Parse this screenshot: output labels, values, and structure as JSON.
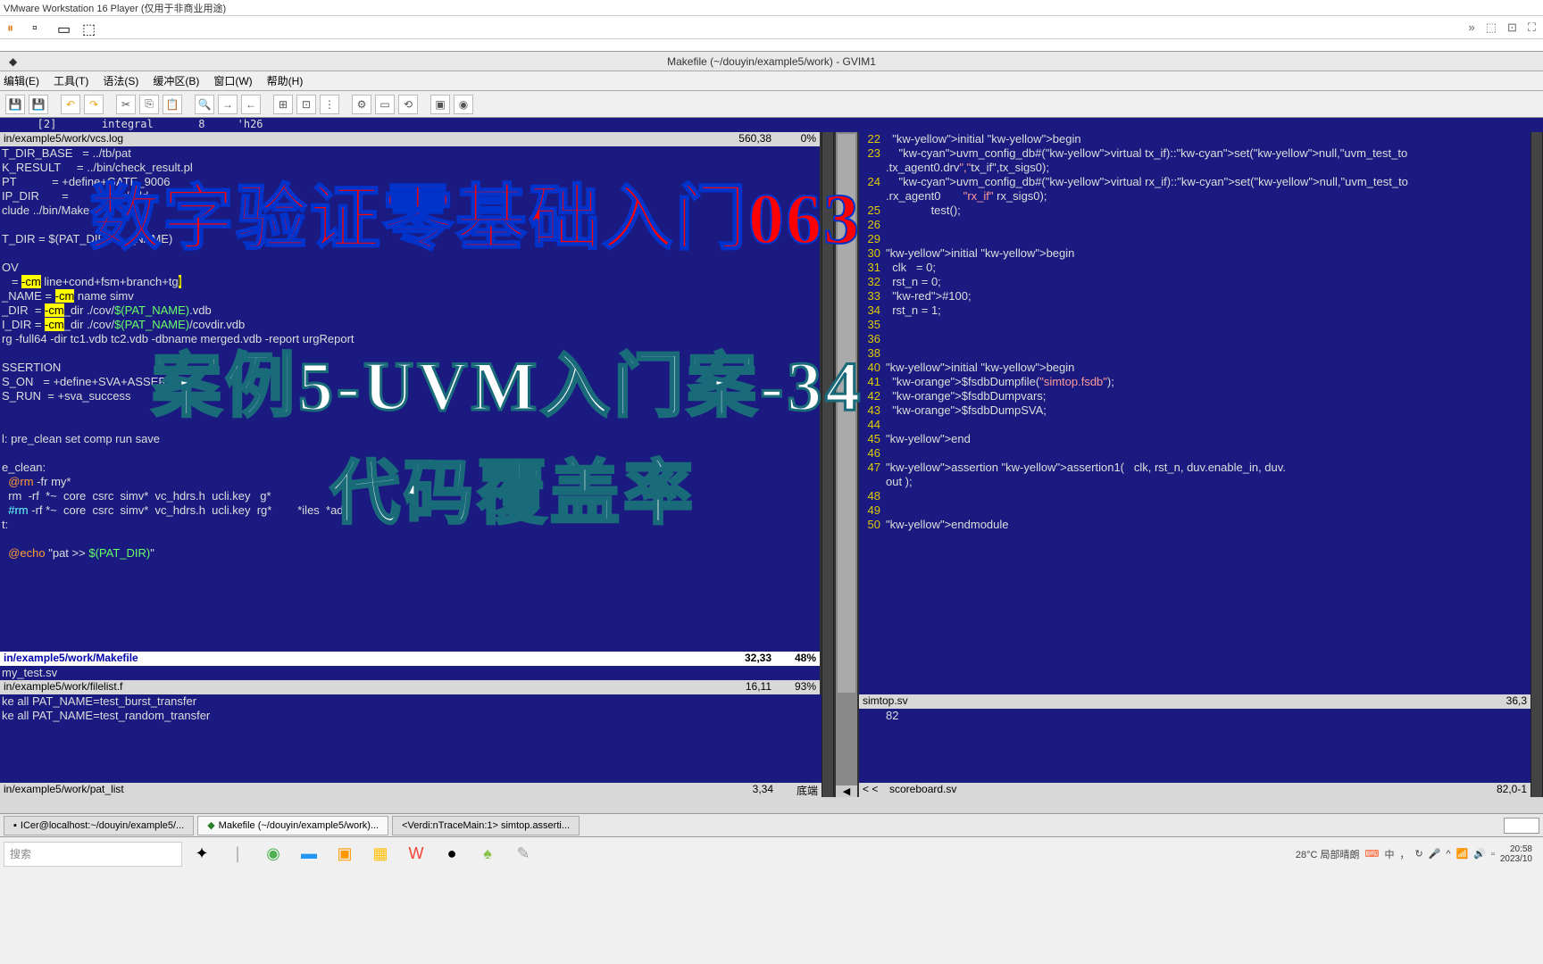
{
  "window": {
    "title": "VMware Workstation 16 Player (仅用于非商业用途)"
  },
  "gvim": {
    "title": "Makefile (~/douyin/example5/work) - GVIM1",
    "menu": [
      "编辑(E)",
      "工具(T)",
      "语法(S)",
      "缓冲区(B)",
      "窗口(W)",
      "帮助(H)"
    ],
    "top_info": "   [2]       integral       8     'h26"
  },
  "left_pane": {
    "status1": {
      "path": "in/example5/work/vcs.log",
      "pos": "560,38",
      "pct": "0%"
    },
    "lines": [
      "T_DIR_BASE   = ../tb/pat",
      "K_RESULT     = ../bin/check_result.pl",
      "PT           = +define+GATE_9006",
      "IP_DIR       =         )/v   v/add",
      "clude ../bin/Make",
      "",
      "T_DIR = $(PAT_DIR       _NAME)",
      "",
      "OV",
      "   = -cm line+cond+fsm+branch+tgl",
      "_NAME = -cm name simv",
      "_DIR  = -cm_dir ./cov/$(PAT_NAME).vdb",
      "I_DIR = -cm_dir ./cov/$(PAT_NAME)/covdir.vdb",
      "rg -full64 -dir tc1.vdb tc2.vdb -dbname merged.vdb -report urgReport",
      "",
      "SSERTION",
      "S_ON   = +define+SVA+ASSERT",
      "S_RUN  = +sva_success",
      "",
      "",
      "l: pre_clean set comp run save",
      "",
      "e_clean:",
      "  @rm -fr my*",
      "  rm  -rf  *~  core  csrc  simv*  vc_hdrs.h  ucli.key   g*",
      "  #rm -rf *~  core  csrc  simv*  vc_hdrs.h  ucli.key  rg*        *iles  *ad",
      "t:",
      "",
      "  @echo \"pat >> $(PAT_DIR)\""
    ],
    "status2": {
      "path": "in/example5/work/Makefile",
      "pos": "32,33",
      "pct": "48%"
    },
    "lines2": [
      "my_test.sv"
    ],
    "status3": {
      "path": "in/example5/work/filelist.f",
      "pos": "16,11",
      "pct": "93%"
    },
    "lines3": [
      "ke all PAT_NAME=test_burst_transfer",
      "ke all PAT_NAME=test_random_transfer"
    ],
    "status4": {
      "path": "in/example5/work/pat_list",
      "pos": "3,34",
      "pct": "底端"
    }
  },
  "right_pane": {
    "lines": [
      {
        "n": 22,
        "t": "  initial begin"
      },
      {
        "n": 23,
        "t": "    uvm_config_db#(virtual tx_if)::set(null,\"uvm_test_to"
      },
      {
        "n": "",
        "t": ".tx_agent0.drv\",\"tx_if\",tx_sigs0);"
      },
      {
        "n": 24,
        "t": "    uvm_config_db#(virtual rx_if)::set(null,\"uvm_test_to"
      },
      {
        "n": "",
        "t": ".rx_agent0       \"rx_if\" rx_sigs0);"
      },
      {
        "n": 25,
        "t": "              test();"
      },
      {
        "n": 26,
        "t": ""
      },
      {
        "n": 29,
        "t": ""
      },
      {
        "n": 30,
        "t": "initial begin"
      },
      {
        "n": 31,
        "t": "  clk   = 0;"
      },
      {
        "n": 32,
        "t": "  rst_n = 0;"
      },
      {
        "n": 33,
        "t": "  #100;"
      },
      {
        "n": 34,
        "t": "  rst_n = 1;"
      },
      {
        "n": 35,
        "t": ""
      },
      {
        "n": 36,
        "t": ""
      },
      {
        "n": 38,
        "t": ""
      },
      {
        "n": 40,
        "t": "initial begin"
      },
      {
        "n": 41,
        "t": "  $fsdbDumpfile(\"simtop.fsdb\");"
      },
      {
        "n": 42,
        "t": "  $fsdbDumpvars;"
      },
      {
        "n": 43,
        "t": "  $fsdbDumpSVA;"
      },
      {
        "n": 44,
        "t": ""
      },
      {
        "n": 45,
        "t": "end"
      },
      {
        "n": 46,
        "t": ""
      },
      {
        "n": 47,
        "t": "assertion assertion1(   clk, rst_n, duv.enable_in, duv."
      },
      {
        "n": "",
        "t": "out );"
      },
      {
        "n": 48,
        "t": ""
      },
      {
        "n": 49,
        "t": ""
      },
      {
        "n": 50,
        "t": "endmodule"
      }
    ],
    "status1": {
      "path": "simtop.sv",
      "pos": "36,3",
      "pct": ""
    },
    "lines2": [
      "82"
    ],
    "status2": {
      "path": "scoreboard.sv",
      "pos": "82,0-1",
      "pct": ""
    }
  },
  "cmdline_right": "< <",
  "taskbar": {
    "items": [
      "ICer@localhost:~/douyin/example5/...",
      "Makefile (~/douyin/example5/work)...",
      "<Verdi:nTraceMain:1> simtop.asserti..."
    ],
    "weather": "28°C 局部晴朗",
    "time": "20:58",
    "date": "2023/10",
    "search_placeholder": "搜索"
  },
  "overlay": {
    "title1": "数字验证零基础入门063",
    "title2": "案例5-UVM入门案-34",
    "title3": "代码覆盖率"
  }
}
